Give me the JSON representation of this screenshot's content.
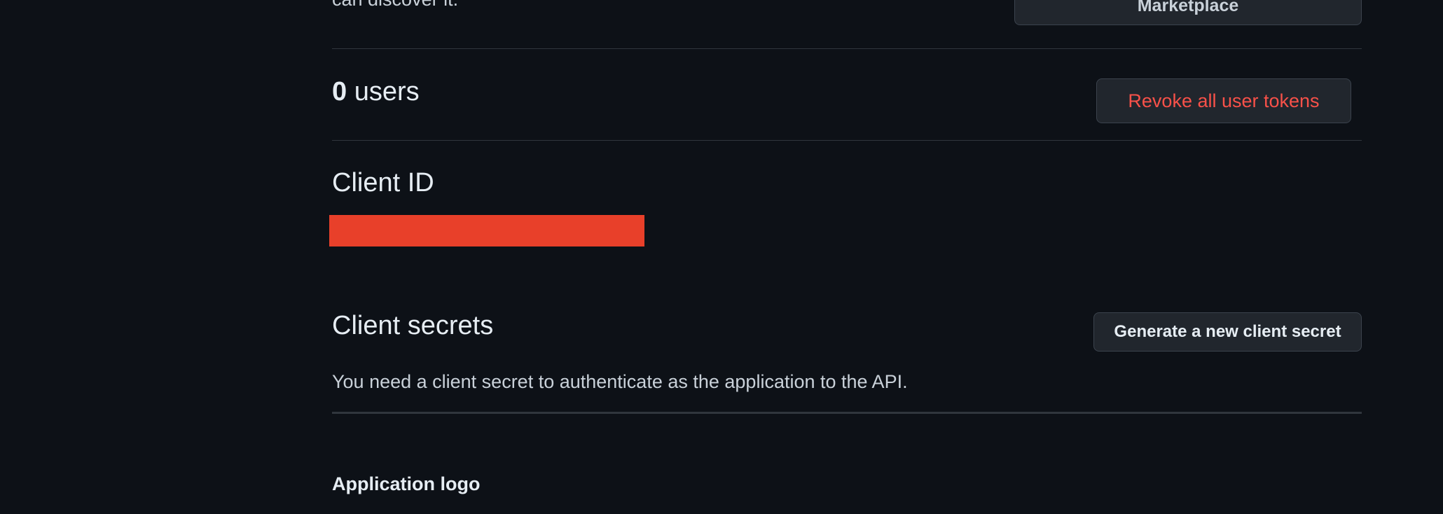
{
  "intro": {
    "text": "can discover it."
  },
  "marketplace": {
    "button_label": "Marketplace"
  },
  "users": {
    "count": "0",
    "label": " users",
    "revoke_label": "Revoke all user tokens"
  },
  "client_id": {
    "heading": "Client ID"
  },
  "client_secrets": {
    "heading": "Client secrets",
    "generate_label": "Generate a new client secret",
    "description": "You need a client secret to authenticate as the application to the API."
  },
  "application_logo": {
    "label": "Application logo"
  },
  "colors": {
    "background": "#0d1117",
    "danger": "#f85149",
    "redaction": "#e8402a",
    "button_bg": "#21262d",
    "border": "#30363d"
  }
}
